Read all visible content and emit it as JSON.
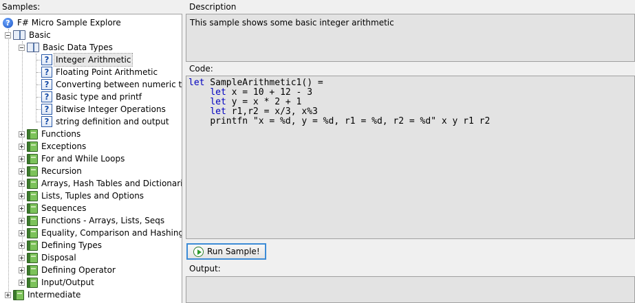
{
  "labels": {
    "samples": "Samples:",
    "description": "Description",
    "code": "Code:",
    "output": "Output:"
  },
  "tree": {
    "root": "F# Micro Sample Explore",
    "basic": "Basic",
    "basic_data_types": "Basic Data Types",
    "leaves": [
      "Integer Arithmetic",
      "Floating Point Arithmetic",
      "Converting between numeric typ",
      "Basic type and printf",
      "Bitwise Integer Operations",
      "string definition and output"
    ],
    "categories": [
      "Functions",
      "Exceptions",
      "For and While Loops",
      "Recursion",
      "Arrays, Hash Tables and Dictionarie",
      "Lists, Tuples and Options",
      "Sequences",
      "Functions - Arrays, Lists, Seqs",
      "Equality, Comparison and Hashing",
      "Defining Types",
      "Disposal",
      "Defining Operator",
      "Input/Output"
    ],
    "intermediate": "Intermediate"
  },
  "description_text": "This sample shows some basic integer arithmetic",
  "code": {
    "line1_kw": "let",
    "line1_rest": " SampleArithmetic1() =",
    "line2_kw": "let",
    "line2_rest": " x = 10 + 12 - 3",
    "line3_kw": "let",
    "line3_rest": " y = x * 2 + 1",
    "line4_kw": "let",
    "line4_rest": " r1,r2 = x/3, x%3",
    "line5": "printfn \"x = %d, y = %d, r1 = %d, r2 = %d\" x y r1 r2"
  },
  "run_button_label": "Run Sample!",
  "icons": {
    "root": "help-circle-icon",
    "category": "book-icon",
    "open_category": "open-book-icon",
    "sample": "help-page-icon",
    "run": "play-icon"
  }
}
